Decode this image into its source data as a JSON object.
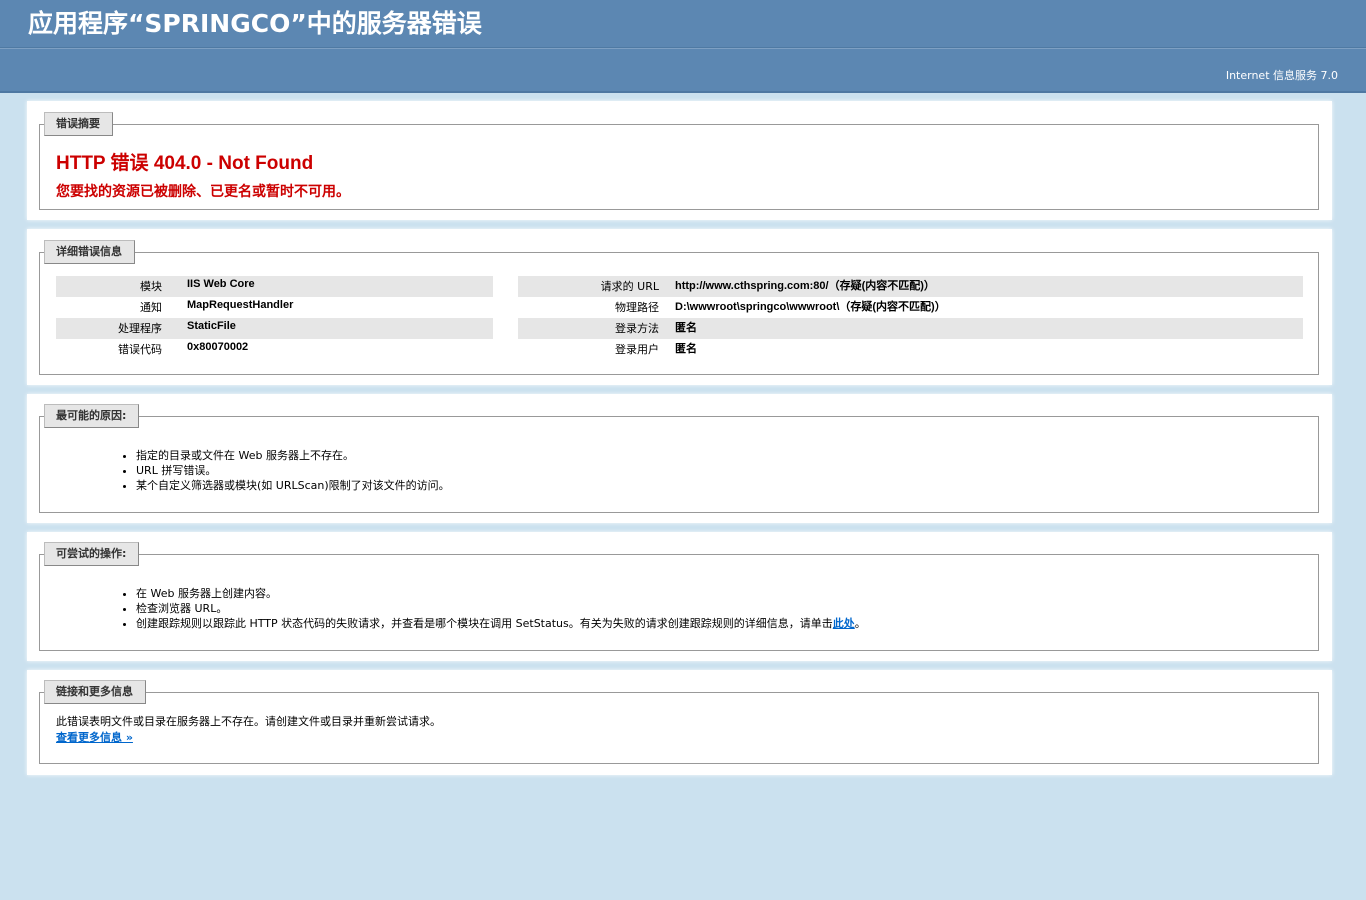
{
  "header": {
    "title": "应用程序“SPRINGCO”中的服务器错误",
    "server_version": "Internet 信息服务 7.0"
  },
  "summary": {
    "legend": "错误摘要",
    "title": "HTTP 错误 404.0 - Not Found",
    "subtitle": "您要找的资源已被删除、已更名或暂时不可用。"
  },
  "details": {
    "legend": "详细错误信息",
    "left": [
      {
        "label": "模块",
        "value": "IIS Web Core"
      },
      {
        "label": "通知",
        "value": "MapRequestHandler"
      },
      {
        "label": "处理程序",
        "value": "StaticFile"
      },
      {
        "label": "错误代码",
        "value": "0x80070002"
      }
    ],
    "right": [
      {
        "label": "请求的 URL",
        "value": "http://www.cthspring.com:80/（存疑(内容不匹配)）"
      },
      {
        "label": "物理路径",
        "value": "D:\\wwwroot\\springco\\wwwroot\\（存疑(内容不匹配)）"
      },
      {
        "label": "登录方法",
        "value": "匿名"
      },
      {
        "label": "登录用户",
        "value": "匿名"
      }
    ]
  },
  "causes": {
    "legend": "最可能的原因:",
    "items": [
      "指定的目录或文件在 Web 服务器上不存在。",
      "URL 拼写错误。",
      "某个自定义筛选器或模块(如 URLScan)限制了对该文件的访问。"
    ]
  },
  "actions": {
    "legend": "可尝试的操作:",
    "items": [
      "在 Web 服务器上创建内容。",
      "检查浏览器 URL。"
    ],
    "trace_text": "创建跟踪规则以跟踪此 HTTP 状态代码的失败请求，并查看是哪个模块在调用 SetStatus。有关为失败的请求创建跟踪规则的详细信息，请单击",
    "trace_link": "此处",
    "trace_end": "。"
  },
  "links": {
    "legend": "链接和更多信息",
    "text": "此错误表明文件或目录在服务器上不存在。请创建文件或目录并重新尝试请求。",
    "more_link": "查看更多信息 »"
  }
}
